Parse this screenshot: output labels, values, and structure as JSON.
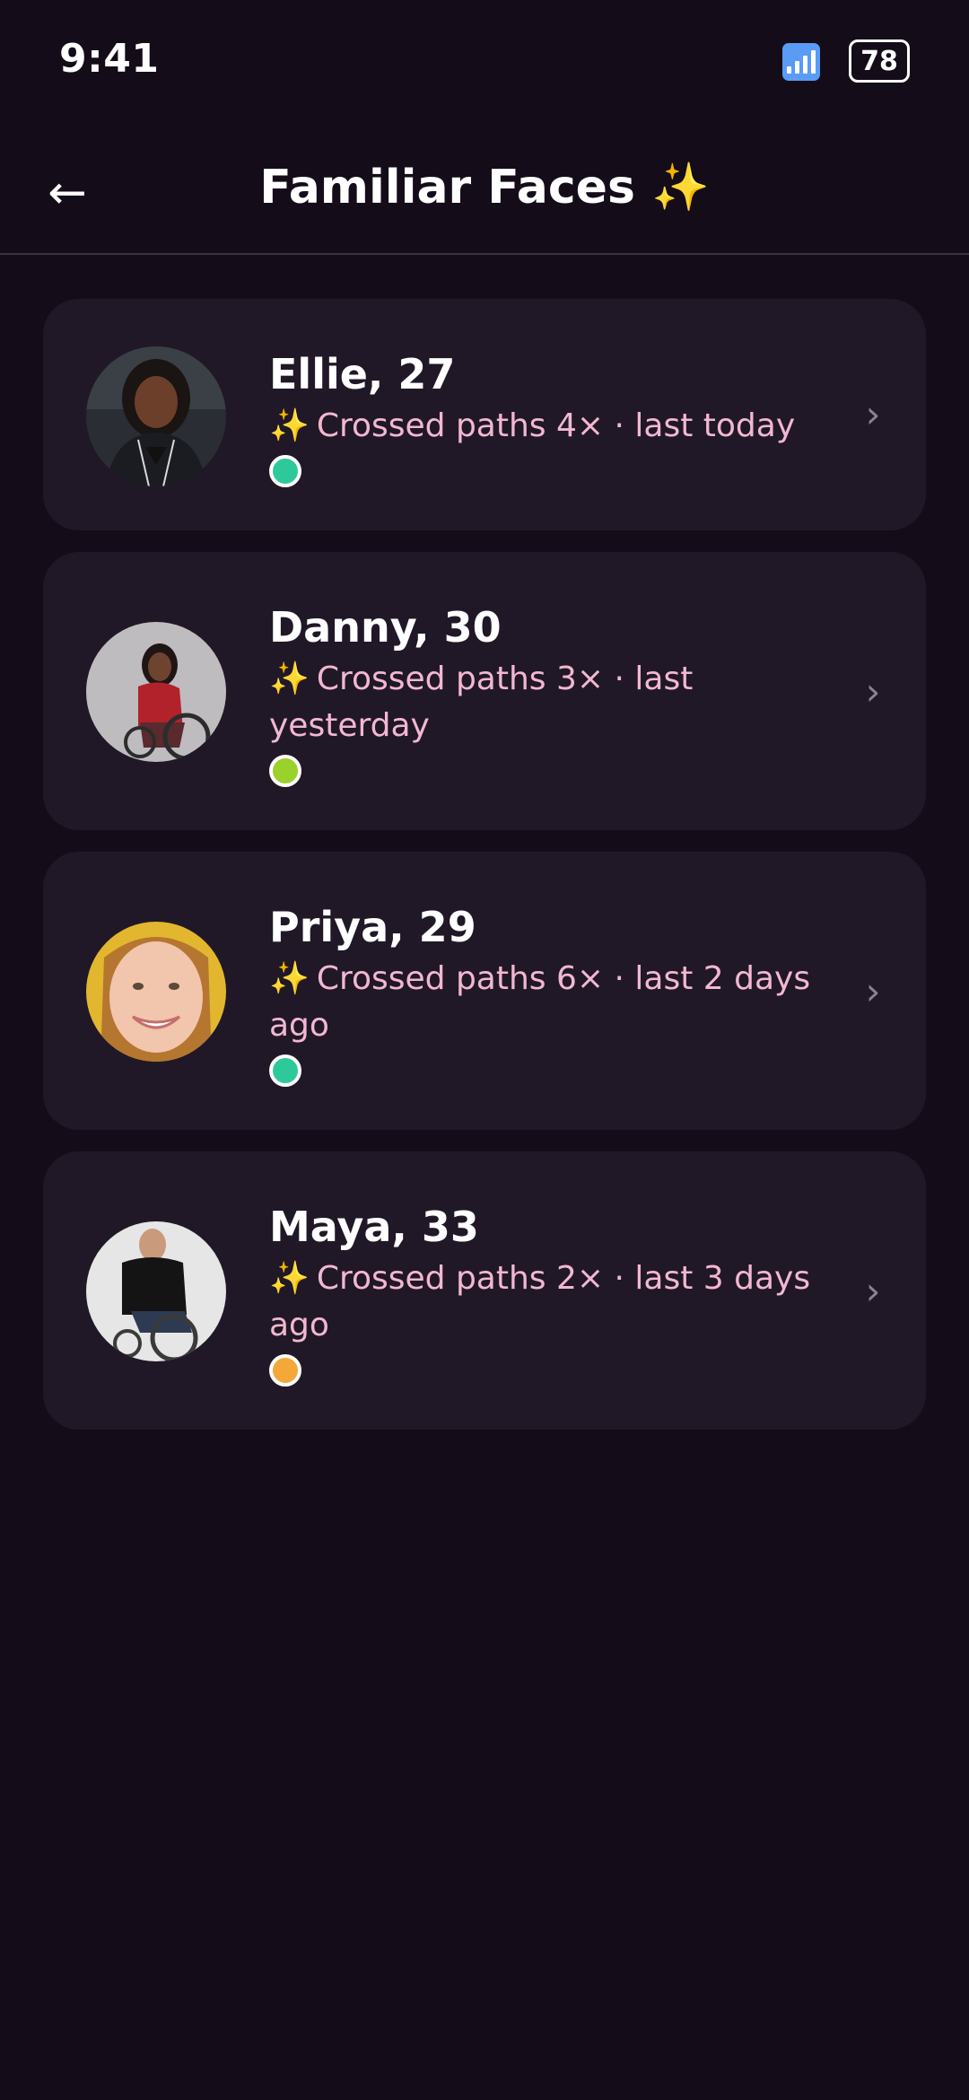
{
  "status_bar": {
    "time": "9:41",
    "battery": "78",
    "signal_icon": "signal-bars-icon"
  },
  "header": {
    "back_icon": "←",
    "title": "Familiar Faces ✨"
  },
  "colors": {
    "background": "#140d19",
    "card": "#211827",
    "subtitle": "#f2b8d1",
    "accent_sparkle": "#f6b73c"
  },
  "people": [
    {
      "name": "Ellie, 27",
      "sparkle": "✨",
      "subtitle": "Crossed paths 4× · last today",
      "status_color": "#2ec99a",
      "avatar_bg": "#2a2d33"
    },
    {
      "name": "Danny, 30",
      "sparkle": "✨",
      "subtitle": "Crossed paths 3× · last yesterday",
      "status_color": "#9ad12b",
      "avatar_bg": "#bfbcc0"
    },
    {
      "name": "Priya, 29",
      "sparkle": "✨",
      "subtitle": "Crossed paths 6× · last 2 days ago",
      "status_color": "#2ec99a",
      "avatar_bg": "#e3b62f"
    },
    {
      "name": "Maya, 33",
      "sparkle": "✨",
      "subtitle": "Crossed paths 2× · last 3 days ago",
      "status_color": "#f5a83a",
      "avatar_bg": "#e6e6e6"
    }
  ]
}
